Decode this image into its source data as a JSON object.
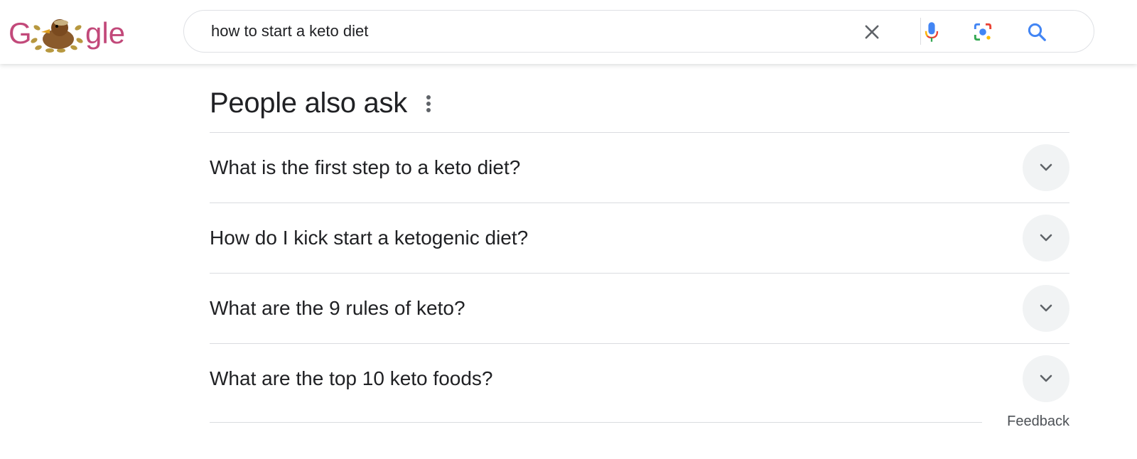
{
  "header": {
    "logo_text": "Google",
    "search_value": "how to start a keto diet",
    "icons": {
      "clear": "close-icon",
      "voice": "microphone-icon",
      "lens": "camera-lens-icon",
      "search": "search-icon"
    }
  },
  "paa": {
    "title": "People also ask",
    "questions": [
      {
        "text": "What is the first step to a keto diet?"
      },
      {
        "text": "How do I kick start a ketogenic diet?"
      },
      {
        "text": "What are the 9 rules of keto?"
      },
      {
        "text": "What are the top 10 keto foods?"
      }
    ],
    "feedback": "Feedback"
  },
  "colors": {
    "logo_pink": "#c2497a",
    "blue": "#4285f4",
    "red": "#ea4335",
    "yellow": "#fbbc04",
    "green": "#34a853",
    "text": "#202124",
    "divider": "#dadce0",
    "chevron_bg": "#f1f3f4"
  }
}
